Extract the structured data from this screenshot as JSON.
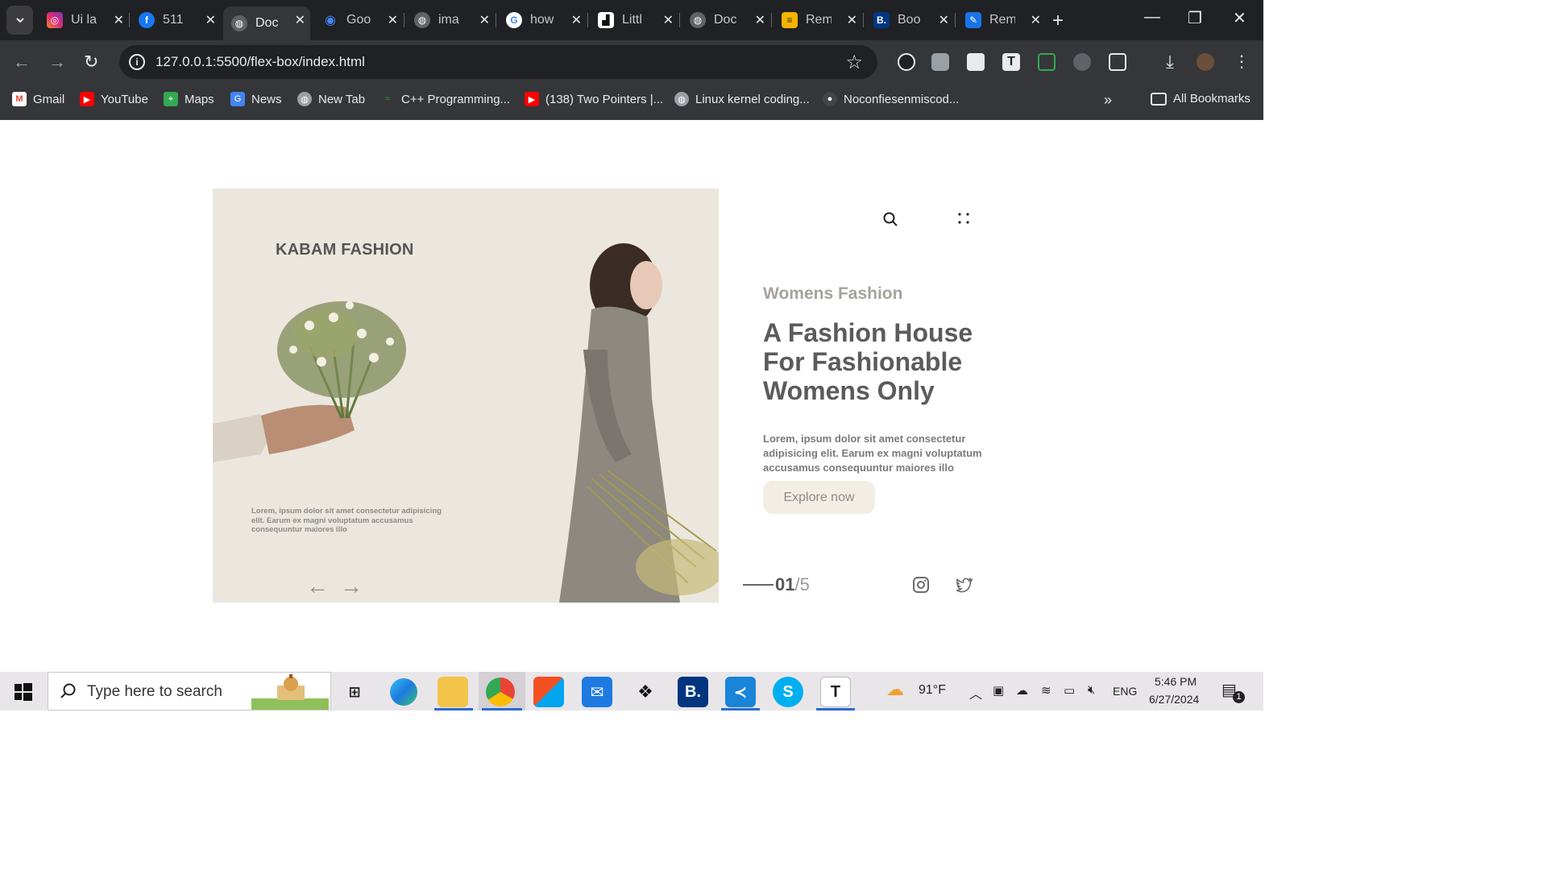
{
  "browser": {
    "tabs": [
      {
        "title": "Ui la",
        "icon": "instagram-icon",
        "color": "#d62976"
      },
      {
        "title": "511",
        "icon": "facebook-icon",
        "color": "#1877f2"
      },
      {
        "title": "Doc",
        "icon": "globe-icon",
        "color": "#5f6368",
        "active": true
      },
      {
        "title": "Goo",
        "icon": "google-lens-icon",
        "color": "#4285f4"
      },
      {
        "title": "ima",
        "icon": "globe-icon",
        "color": "#5f6368"
      },
      {
        "title": "how",
        "icon": "google-icon",
        "color": "#ffffff"
      },
      {
        "title": "Littl",
        "icon": "littleshop-icon",
        "color": "#111111"
      },
      {
        "title": "Doc",
        "icon": "globe-icon",
        "color": "#5f6368"
      },
      {
        "title": "Rem",
        "icon": "remnote-icon",
        "color": "#f4b400"
      },
      {
        "title": "Boo",
        "icon": "booking-icon",
        "color": "#003580"
      },
      {
        "title": "Rem",
        "icon": "remnote-blue-icon",
        "color": "#1a73e8"
      }
    ],
    "url": "127.0.0.1:5500/flex-box/index.html",
    "bookmarks": [
      {
        "label": "Gmail",
        "icon": "gmail-icon",
        "color": "#ea4335"
      },
      {
        "label": "YouTube",
        "icon": "youtube-icon",
        "color": "#ff0000"
      },
      {
        "label": "Maps",
        "icon": "maps-icon",
        "color": "#34a853"
      },
      {
        "label": "News",
        "icon": "news-icon",
        "color": "#4285f4"
      },
      {
        "label": "New Tab",
        "icon": "globe-icon",
        "color": "#9aa0a6"
      },
      {
        "label": "C++ Programming...",
        "icon": "cpp-icon",
        "color": "#2e7d32"
      },
      {
        "label": "(138) Two Pointers |...",
        "icon": "youtube-icon",
        "color": "#ff0000"
      },
      {
        "label": "Linux kernel coding...",
        "icon": "globe-icon",
        "color": "#9aa0a6"
      },
      {
        "label": "Noconfiesenmiscod...",
        "icon": "github-icon",
        "color": "#444444"
      }
    ],
    "all_bookmarks": "All Bookmarks"
  },
  "page": {
    "brand": "KABAM FASHION",
    "hero_text": "Lorem, ipsum dolor sit amet consectetur adipisicing elit. Earum ex magni voluptatum accusamus consequuntur maiores illo",
    "eyebrow": "Womens Fashion",
    "headline": "A Fashion House For Fashionable Womens Only",
    "description": "Lorem, ipsum dolor sit amet consectetur adipisicing elit. Earum ex magni voluptatum accusamus consequuntur maiores illo",
    "cta": "Explore now",
    "pager_current": "01",
    "pager_total": "/5",
    "colors": {
      "hero_bg": "#ece7de",
      "eyebrow": "#a6a39c",
      "headline": "#5b5b5b",
      "cta_bg": "#f2eee3"
    }
  },
  "taskbar": {
    "search_placeholder": "Type here to search",
    "weather": "91°F",
    "language": "ENG",
    "time": "5:46 PM",
    "date": "6/27/2024",
    "notification_count": "1"
  }
}
